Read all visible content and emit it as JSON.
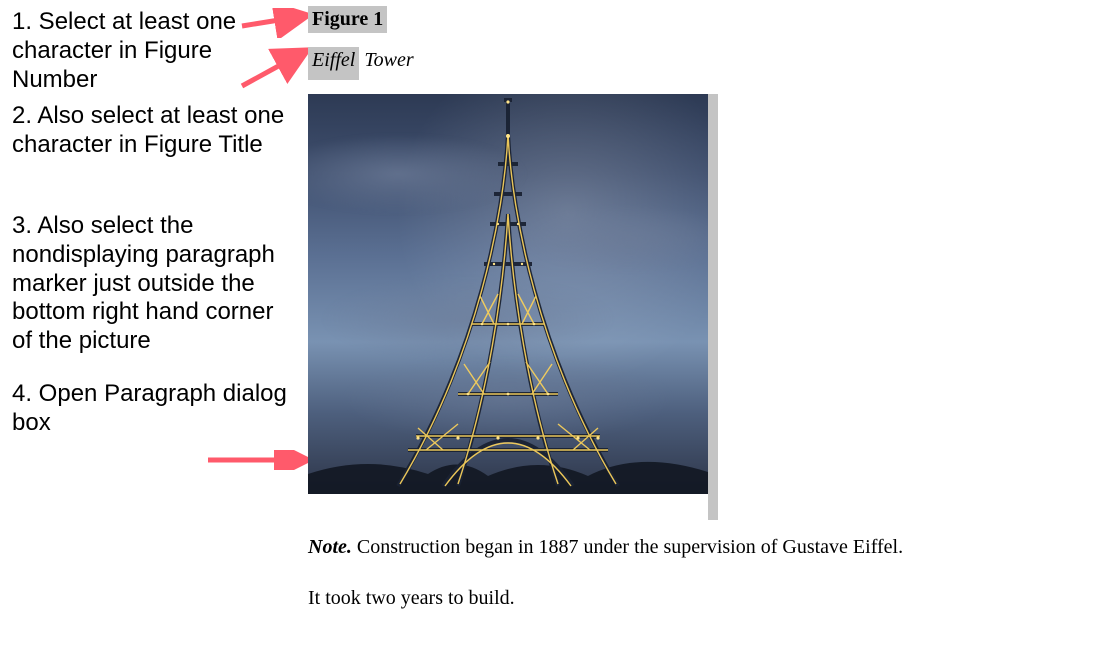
{
  "instructions": {
    "step1": "1. Select at least one character in Figure Number",
    "step2": "2. Also select at least one character in Figure Title",
    "step3": "3. Also select the nondisplaying paragraph marker just outside the bottom right hand corner of the picture",
    "step4": "4. Open Paragraph dialog box"
  },
  "figure": {
    "number_prefix": "Figure",
    "number_rest": " 1",
    "title_prefix": "Eiffel",
    "title_rest": " Tower",
    "note_label": "Note.",
    "note_text": " Construction began in 1887 under the supervision of Gustave Eiffel.",
    "note_text2": "It took two years to build.",
    "image_alt": "Eiffel Tower at dusk with lights on against a cloudy blue sky"
  },
  "colors": {
    "arrow": "#ff5a6b",
    "highlight": "#c4c4c4"
  }
}
